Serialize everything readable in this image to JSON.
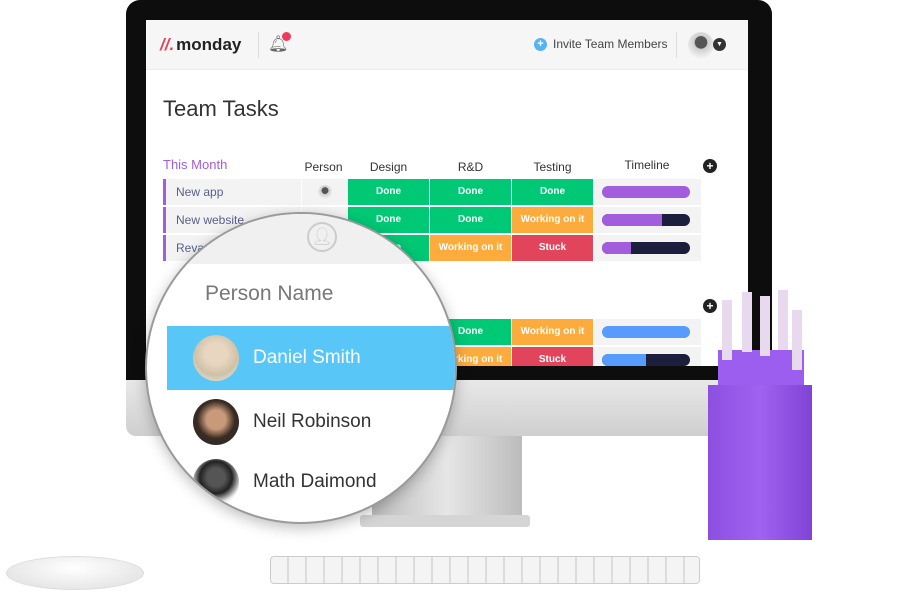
{
  "app": {
    "logo": "monday",
    "invite_label": "Invite Team Members"
  },
  "board": {
    "title": "Team Tasks",
    "group_name": "This Month",
    "columns": [
      "Person",
      "Design",
      "R&D",
      "Testing",
      "Timeline"
    ],
    "rows": [
      {
        "name": "New app",
        "design": "Done",
        "rnd": "Done",
        "testing": "Done",
        "timeline_progress": 1.0
      },
      {
        "name": "New website",
        "design": "Done",
        "rnd": "Done",
        "testing": "Working on it",
        "timeline_progress": 0.68
      },
      {
        "name": "Revamp",
        "design": "Done",
        "rnd": "Working on it",
        "testing": "Stuck",
        "timeline_progress": 0.33
      }
    ],
    "group2_rows": [
      {
        "rnd": "Done",
        "testing": "Working on it",
        "timeline_progress": 1.0
      },
      {
        "rnd": "Working on it",
        "testing": "Stuck",
        "timeline_progress": 0.5
      }
    ]
  },
  "colors": {
    "done": "#00c875",
    "working": "#fdab3d",
    "stuck": "#e2445c",
    "purple": "#a25ddc",
    "blue": "#579bfc",
    "selected": "#58c6f7"
  },
  "person_picker": {
    "title": "Person Name",
    "people": [
      {
        "name": "Daniel Smith",
        "selected": true
      },
      {
        "name": "Neil Robinson",
        "selected": false
      },
      {
        "name": "Math Daimond",
        "selected": false
      }
    ]
  }
}
